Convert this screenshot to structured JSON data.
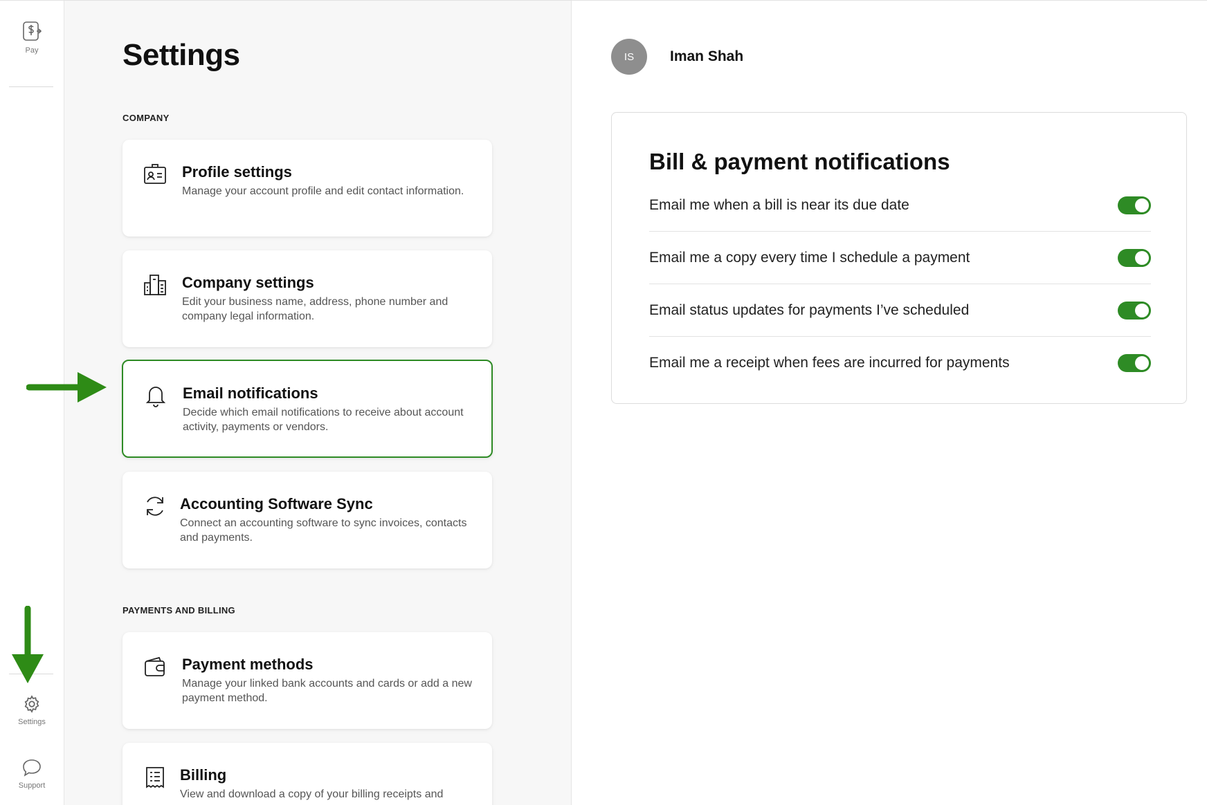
{
  "nav": {
    "pay_label": "Pay",
    "settings_label": "Settings",
    "support_label": "Support"
  },
  "settings": {
    "title": "Settings",
    "section_company": "COMPANY",
    "section_payments": "PAYMENTS AND BILLING",
    "cards": [
      {
        "title": "Profile settings",
        "desc": "Manage your account profile and edit contact information.",
        "icon": "profile-badge-icon"
      },
      {
        "title": "Company settings",
        "desc": "Edit your business name, address, phone number and company legal information.",
        "icon": "building-icon"
      },
      {
        "title": "Email notifications",
        "desc": "Decide which email notifications to receive about account activity, payments or vendors.",
        "icon": "bell-icon",
        "selected": true
      },
      {
        "title": "Accounting Software Sync",
        "desc": "Connect an accounting software to sync invoices, contacts and payments.",
        "icon": "sync-icon"
      },
      {
        "title": "Payment methods",
        "desc": "Manage your linked bank accounts and cards or add a new payment method.",
        "icon": "wallet-icon"
      },
      {
        "title": "Billing",
        "desc": "View and download a copy of your billing receipts and",
        "icon": "receipt-icon"
      }
    ]
  },
  "user": {
    "initials": "IS",
    "name": "Iman Shah"
  },
  "notifications": {
    "title": "Bill & payment notifications",
    "rows": [
      {
        "label": "Email me when a bill is near its due date",
        "enabled": true
      },
      {
        "label": "Email me a copy every time I schedule a payment",
        "enabled": true
      },
      {
        "label": "Email status updates for payments I’ve scheduled",
        "enabled": true
      },
      {
        "label": "Email me a receipt when fees are incurred for payments",
        "enabled": true
      }
    ]
  },
  "colors": {
    "accent_green": "#2e8b25",
    "arrow_green": "#2e8b16",
    "avatar_gray": "#8e8e8e",
    "panel_bg": "#f7f7f7"
  }
}
